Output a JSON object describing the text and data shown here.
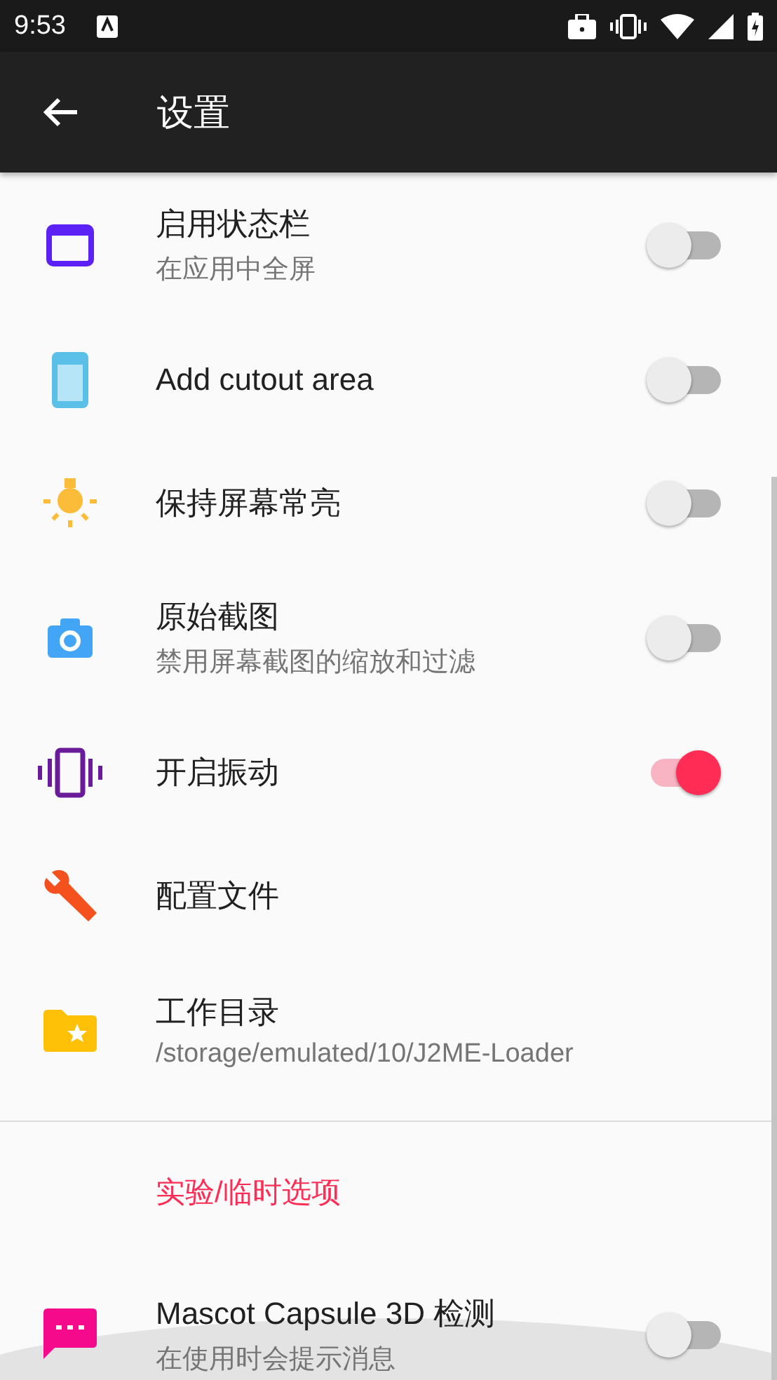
{
  "status_bar": {
    "time": "9:53"
  },
  "app_bar": {
    "title": "设置"
  },
  "items": [
    {
      "title": "启用状态栏",
      "summary": "在应用中全屏",
      "kind": "switch",
      "on": false
    },
    {
      "title": "Add cutout area",
      "kind": "switch",
      "on": false
    },
    {
      "title": "保持屏幕常亮",
      "kind": "switch",
      "on": false
    },
    {
      "title": "原始截图",
      "summary": "禁用屏幕截图的缩放和过滤",
      "kind": "switch",
      "on": false
    },
    {
      "title": "开启振动",
      "kind": "switch",
      "on": true
    },
    {
      "title": "配置文件",
      "kind": "link"
    },
    {
      "title": "工作目录",
      "summary": "/storage/emulated/10/J2ME-Loader",
      "kind": "link"
    }
  ],
  "section": {
    "title": "实验/临时选项",
    "items": [
      {
        "title": "Mascot Capsule 3D 检测",
        "summary": "在使用时会提示消息",
        "kind": "switch",
        "on": false
      }
    ]
  }
}
